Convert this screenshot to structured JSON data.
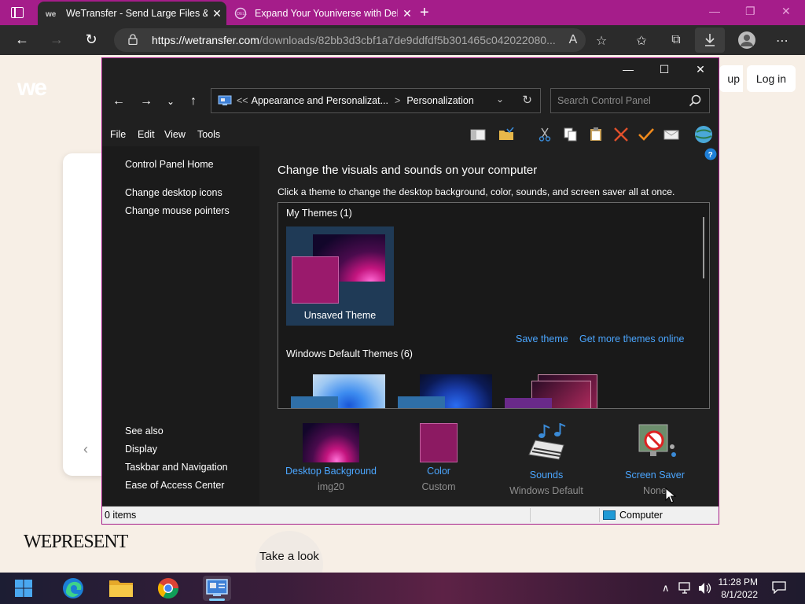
{
  "browser": {
    "tabs": [
      {
        "title": "WeTransfer - Send Large Files &",
        "active": true
      },
      {
        "title": "Expand Your Youniverse with Del",
        "active": false
      }
    ],
    "tab_close": "✕",
    "new_tab": "+",
    "url_host": "https://wetransfer.com",
    "url_path": "/downloads/82bb3d3cbf1a7de9ddfdf5b301465c042022080...",
    "colors": {
      "tabstrip": "#a51d8a",
      "chrome": "#2b2b2b"
    }
  },
  "wetransfer": {
    "logo": "we",
    "login": "Log in",
    "signup_partial": "up",
    "wepresent": "WEPRESENT",
    "take_a_look": "Take a look"
  },
  "control_panel": {
    "breadcrumb": {
      "prefix": "<<",
      "parent": "Appearance and Personalizat...",
      "separator": ">",
      "current": "Personalization"
    },
    "search_placeholder": "Search Control Panel",
    "menu": [
      "File",
      "Edit",
      "View",
      "Tools"
    ],
    "left_links": [
      "Control Panel Home",
      "Change desktop icons",
      "Change mouse pointers"
    ],
    "see_also_title": "See also",
    "see_also": [
      "Display",
      "Taskbar and Navigation",
      "Ease of Access Center"
    ],
    "title": "Change the visuals and sounds on your computer",
    "subtitle": "Click a theme to change the desktop background, color, sounds, and screen saver all at once.",
    "my_themes": "My Themes (1)",
    "unsaved_theme": "Unsaved Theme",
    "save_theme": "Save theme",
    "get_more": "Get more themes online",
    "default_themes": "Windows Default Themes (6)",
    "bottom": [
      {
        "name": "Desktop Background",
        "value": "img20"
      },
      {
        "name": "Color",
        "value": "Custom"
      },
      {
        "name": "Sounds",
        "value": "Windows Default"
      },
      {
        "name": "Screen Saver",
        "value": "None"
      }
    ],
    "status_items": "0 items",
    "status_location": "Computer",
    "accent": "#4ba6ff"
  },
  "taskbar": {
    "time": "11:28 PM",
    "date": "8/1/2022"
  }
}
